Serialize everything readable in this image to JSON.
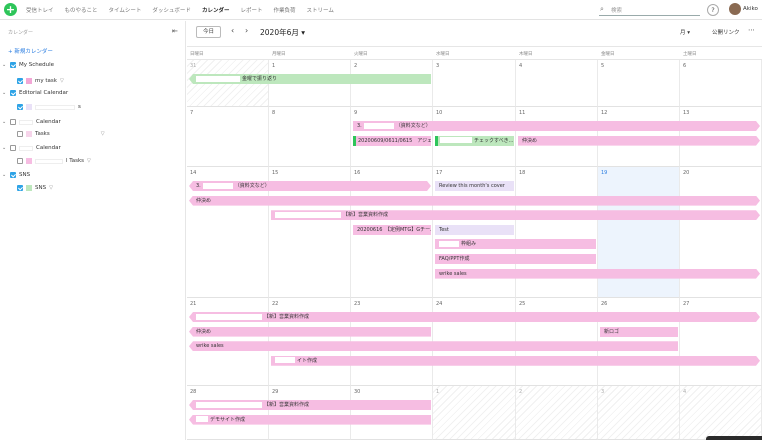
{
  "nav": {
    "items": [
      "受信トレイ",
      "ものやること",
      "タイムシート",
      "ダッシュボード",
      "カレンダー",
      "レポート",
      "作業負荷",
      "ストリーム"
    ],
    "active": "カレンダー"
  },
  "search": {
    "placeholder": "検索"
  },
  "help_label": "?",
  "user": {
    "name": "Akiko"
  },
  "sidebar": {
    "title": "カレンダー",
    "new_calendar": "+ 新規カレンダー",
    "items": [
      {
        "label": "My Schedule",
        "level": 0,
        "checked": true,
        "color": ""
      },
      {
        "label": "my task",
        "level": 1,
        "checked": true,
        "color": "#f2a7d6"
      },
      {
        "label": "Editorial Calendar",
        "level": 0,
        "checked": true,
        "color": ""
      },
      {
        "label": "s",
        "level": 1,
        "checked": true,
        "color": "#e9e1f7"
      },
      {
        "label": "Calendar",
        "level": 0,
        "checked": false,
        "color": ""
      },
      {
        "label": "Tasks",
        "level": 1,
        "checked": false,
        "color": "#f6d4ea"
      },
      {
        "label": "Calendar",
        "level": 0,
        "checked": false,
        "color": ""
      },
      {
        "label": "l Tasks",
        "level": 1,
        "checked": false,
        "color": "#f6bde2"
      },
      {
        "label": "SNS",
        "level": 0,
        "checked": true,
        "color": ""
      },
      {
        "label": "SNS",
        "level": 1,
        "checked": true,
        "color": "#bde7bd"
      }
    ]
  },
  "toolbar": {
    "today": "今日",
    "month_label": "2020年6月 ▾",
    "view": "月 ▾",
    "public_link": "公開リンク",
    "more": "⋯"
  },
  "weekdays": [
    "日曜日",
    "月曜日",
    "火曜日",
    "水曜日",
    "木曜日",
    "金曜日",
    "土曜日"
  ],
  "weeks": [
    {
      "days": [
        "31",
        "1",
        "2",
        "3",
        "4",
        "5",
        "6"
      ]
    },
    {
      "days": [
        "7",
        "8",
        "9",
        "10",
        "11",
        "12",
        "13"
      ]
    },
    {
      "days": [
        "14",
        "15",
        "16",
        "17",
        "18",
        "19",
        "20"
      ]
    },
    {
      "days": [
        "21",
        "22",
        "23",
        "24",
        "25",
        "26",
        "27"
      ]
    },
    {
      "days": [
        "28",
        "29",
        "30",
        "1",
        "2",
        "3",
        "4"
      ]
    }
  ],
  "today_day": "19",
  "events": [
    {
      "week": 0,
      "start": 0,
      "end": 2,
      "row": 0,
      "text": "金曜で振り返り",
      "color": "green",
      "shape": "arrL",
      "redact": 44
    },
    {
      "week": 1,
      "start": 2,
      "end": 6,
      "row": 0,
      "text": "（資料文など）",
      "prefix": "3.",
      "color": "pink",
      "shape": "arrR",
      "redact": 30
    },
    {
      "week": 1,
      "start": 2,
      "end": 2,
      "row": 1,
      "text": "20200609/0611/0615　アジェ...",
      "color": "pink",
      "shape": "sq"
    },
    {
      "week": 1,
      "start": 3,
      "end": 3,
      "row": 1,
      "text": "チェックすべき...",
      "color": "green",
      "shape": "sq",
      "redact": 32
    },
    {
      "week": 1,
      "start": 4,
      "end": 6,
      "row": 1,
      "text": "仲決め",
      "color": "pink",
      "shape": "arrR"
    },
    {
      "week": 2,
      "start": 0,
      "end": 2,
      "row": 0,
      "text": "（資料文など）",
      "prefix": "3.",
      "color": "pink",
      "shape": "arrLR",
      "redact": 30
    },
    {
      "week": 2,
      "start": 3,
      "end": 3,
      "row": 0,
      "text": "Review this month's cover",
      "color": "lav",
      "shape": ""
    },
    {
      "week": 2,
      "start": 0,
      "end": 6,
      "row": 1,
      "text": "仲決め",
      "color": "pink",
      "shape": "arrLR"
    },
    {
      "week": 2,
      "start": 1,
      "end": 6,
      "row": 2,
      "text": "【新】営業資料作成",
      "color": "pink",
      "shape": "arrR",
      "redact": 66
    },
    {
      "week": 2,
      "start": 2,
      "end": 2,
      "row": 3,
      "text": "20200616　【定例MTG】Gチーム...",
      "color": "pink",
      "shape": ""
    },
    {
      "week": 2,
      "start": 3,
      "end": 3,
      "row": 3,
      "text": "Test",
      "color": "lav",
      "shape": ""
    },
    {
      "week": 2,
      "start": 3,
      "end": 4,
      "row": 4,
      "text": "枠組み",
      "color": "pink",
      "shape": "",
      "redact": 20
    },
    {
      "week": 2,
      "start": 3,
      "end": 4,
      "row": 5,
      "text": "FAQ/PPT作成",
      "color": "pink",
      "shape": ""
    },
    {
      "week": 2,
      "start": 3,
      "end": 6,
      "row": 6,
      "text": "wrike sales",
      "color": "pink",
      "shape": "arrR"
    },
    {
      "week": 3,
      "start": 0,
      "end": 6,
      "row": 0,
      "text": "【新】営業資料作成",
      "color": "pink",
      "shape": "arrLR",
      "redact": 66
    },
    {
      "week": 3,
      "start": 0,
      "end": 2,
      "row": 1,
      "text": "仲決め",
      "color": "pink",
      "shape": "arrL"
    },
    {
      "week": 3,
      "start": 5,
      "end": 5,
      "row": 1,
      "text": "新ロゴ",
      "color": "pink",
      "shape": ""
    },
    {
      "week": 3,
      "start": 0,
      "end": 5,
      "row": 2,
      "text": "wrike sales",
      "color": "pink",
      "shape": "arrL"
    },
    {
      "week": 3,
      "start": 1,
      "end": 6,
      "row": 3,
      "text": "イト作成",
      "color": "pink",
      "shape": "arrR",
      "redact": 20
    },
    {
      "week": 4,
      "start": 0,
      "end": 2,
      "row": 0,
      "text": "【新】営業資料作成",
      "color": "pink",
      "shape": "arrL",
      "redact": 66
    },
    {
      "week": 4,
      "start": 0,
      "end": 2,
      "row": 1,
      "text": "デモサイト作成",
      "color": "pink",
      "shape": "arrL",
      "redact": 12
    }
  ]
}
